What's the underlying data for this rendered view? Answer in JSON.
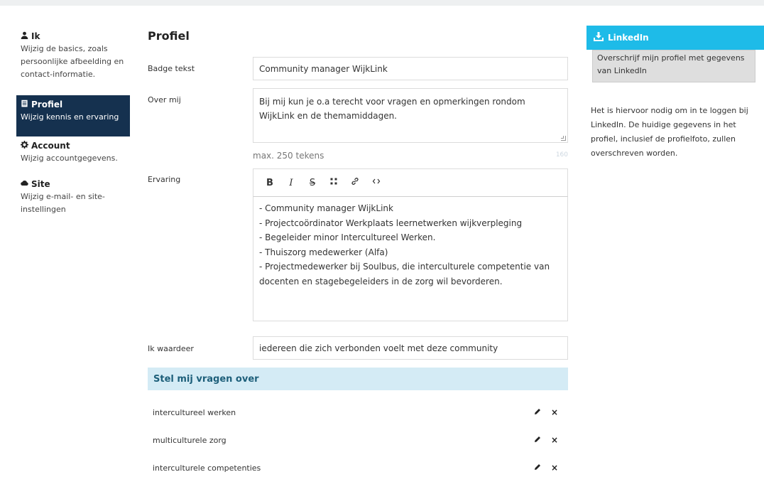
{
  "sidebar": {
    "items": [
      {
        "title": "Ik",
        "desc": "Wijzig de basics, zoals persoonlijke afbeelding en contact-informatie.",
        "icon": "user-icon"
      },
      {
        "title": "Profiel",
        "desc": "Wijzig kennis en ervaring",
        "icon": "document-icon"
      },
      {
        "title": "Account",
        "desc": "Wijzig accountgegevens.",
        "icon": "gear-icon"
      },
      {
        "title": "Site",
        "desc": "Wijzig e-mail- en site-instellingen",
        "icon": "cloud-icon"
      }
    ]
  },
  "profile": {
    "title": "Profiel",
    "badge_label": "Badge tekst",
    "badge_value": "Community manager WijkLink",
    "about_label": "Over mij",
    "about_value": "Bij mij kun je o.a terecht voor vragen en opmerkingen rondom WijkLink en de themamiddagen.",
    "about_hint": "max. 250 tekens",
    "about_counter": "160",
    "experience_label": "Ervaring",
    "experience_lines": [
      "- Community manager WijkLink",
      "- Projectcoördinator Werkplaats leernetwerken wijkverpleging",
      "- Begeleider minor Intercultureel Werken.",
      "- Thuiszorg medewerker (Alfa)",
      "- Projectmedewerker bij Soulbus, die interculturele competentie van docenten en stagebegeleiders in de zorg wil bevorderen."
    ],
    "toolbar": {
      "bold": "B",
      "italic": "I",
      "strike": "S"
    },
    "appreciate_label": "Ik waardeer",
    "appreciate_value": "iedereen die zich verbonden voelt met deze community",
    "questions_title": "Stel mij vragen over",
    "questions": [
      "intercultureel werken",
      "multiculturele zorg",
      "interculturele competenties"
    ],
    "delete_glyph": "×"
  },
  "linkedin": {
    "title": "LinkedIn",
    "button": "Overschrijf mijn profiel met gegevens van LinkedIn",
    "note": "Het is hiervoor nodig om in te loggen bij LinkedIn. De huidige gegevens in het profiel, inclusief de profielfoto, zullen overschreven worden."
  },
  "colors": {
    "sidebar_active": "#15314f",
    "linkedin_blue": "#1ebbe8",
    "section_head_bg": "#d4ebf5",
    "section_head_text": "#1d5f7a"
  }
}
